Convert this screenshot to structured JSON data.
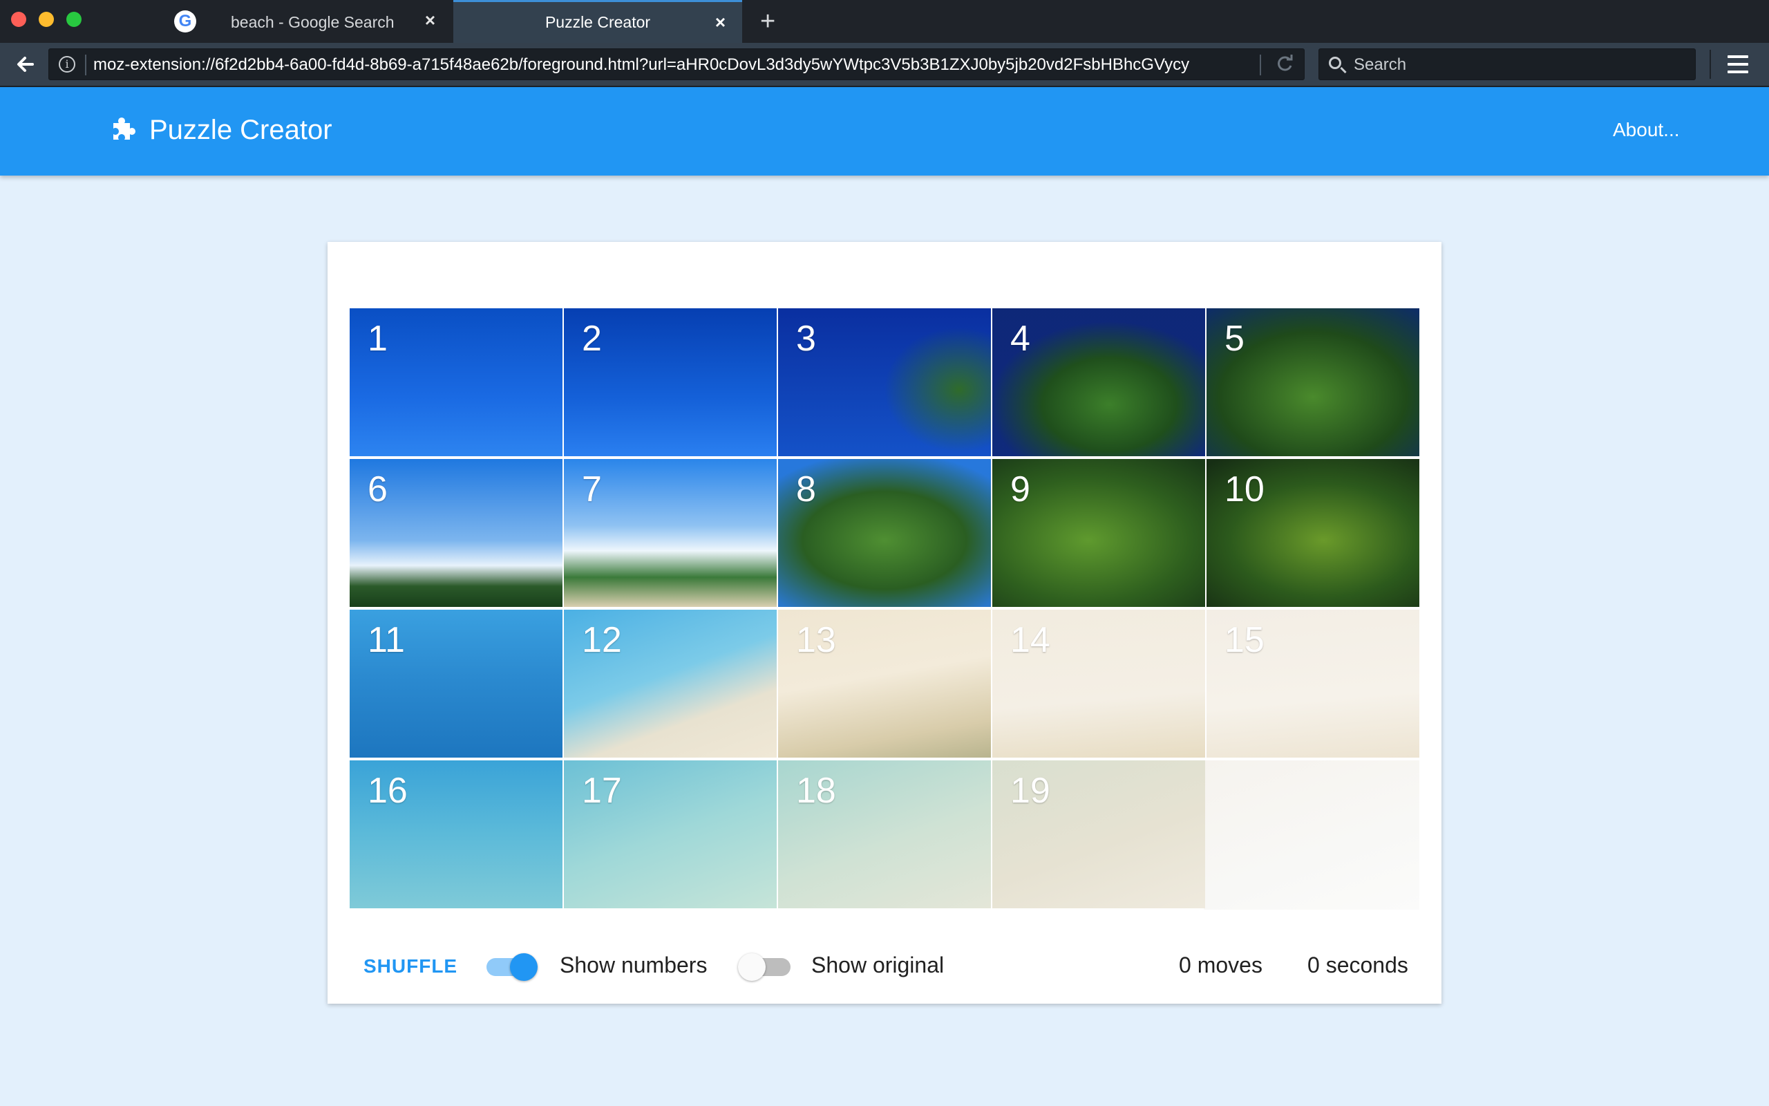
{
  "browser": {
    "tabs": [
      {
        "title": "beach - Google Search",
        "favicon": "G",
        "active": false
      },
      {
        "title": "Puzzle Creator",
        "active": true
      }
    ],
    "new_tab_label": "+",
    "close_label": "×",
    "url": "moz-extension://6f2d2bb4-6a00-fd4d-8b69-a715f48ae62b/foreground.html?url=aHR0cDovL3d3dy5wYWtpc3V5b3B1ZXJ0by5jb20vd2FsbHBhcGVycy",
    "search_placeholder": "Search"
  },
  "app": {
    "title": "Puzzle Creator",
    "about_label": "About...",
    "accent_color": "#2196f3"
  },
  "puzzle": {
    "rows": 4,
    "cols": 5,
    "tiles": [
      "1",
      "2",
      "3",
      "4",
      "5",
      "6",
      "7",
      "8",
      "9",
      "10",
      "11",
      "12",
      "13",
      "14",
      "15",
      "16",
      "17",
      "18",
      "19"
    ]
  },
  "controls": {
    "shuffle_label": "SHUFFLE",
    "show_numbers_label": "Show numbers",
    "show_numbers_on": true,
    "show_original_label": "Show original",
    "show_original_on": false,
    "moves": "0 moves",
    "seconds": "0 seconds"
  }
}
